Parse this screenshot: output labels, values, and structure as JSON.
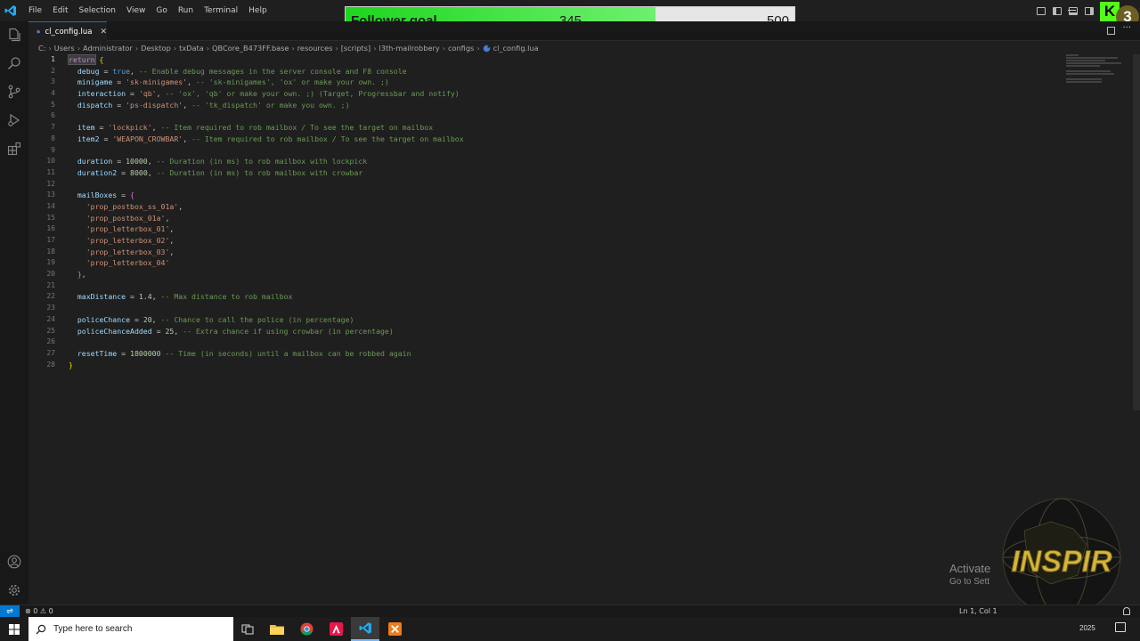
{
  "menu": [
    "File",
    "Edit",
    "Selection",
    "View",
    "Go",
    "Run",
    "Terminal",
    "Help"
  ],
  "overlay": {
    "goal_label": "Follower goal",
    "current": "345",
    "target": "500",
    "progress": 0.69,
    "kick_letter": "K",
    "kick_count": "3"
  },
  "tab": {
    "label": "cl_config.lua",
    "close": "✕"
  },
  "breadcrumb": [
    "C:",
    "Users",
    "Administrator",
    "Desktop",
    "txData",
    "QBCore_B473FF.base",
    "resources",
    "[scripts]",
    "l3th-mailrobbery",
    "configs",
    "cl_config.lua"
  ],
  "line_numbers": [
    "1",
    "2",
    "3",
    "4",
    "5",
    "6",
    "7",
    "8",
    "9",
    "10",
    "11",
    "12",
    "13",
    "14",
    "15",
    "16",
    "17",
    "18",
    "19",
    "20",
    "21",
    "22",
    "23",
    "24",
    "25",
    "26",
    "27",
    "28"
  ],
  "code": {
    "l1_kw": "return",
    "l1_br": " {",
    "l2_prop": "debug",
    "l2_eq": " = ",
    "l2_val": "true",
    "l2_rest": ", ",
    "l2_cmt": "-- Enable debug messages in the server console and F8 console",
    "l3_prop": "minigame",
    "l3_eq": " = ",
    "l3_val": "'sk-minigames'",
    "l3_rest": ", ",
    "l3_cmt": "-- 'sk-minigames', 'ox' or make your own. ;)",
    "l4_prop": "interaction",
    "l4_eq": " = ",
    "l4_val": "'qb'",
    "l4_rest": ", ",
    "l4_cmt": "-- 'ox', 'qb' or make your own. ;) (Target, Progressbar and notify)",
    "l5_prop": "dispatch",
    "l5_eq": " = ",
    "l5_val": "'ps-dispatch'",
    "l5_rest": ", ",
    "l5_cmt": "-- 'tk_dispatch' or make you own. ;)",
    "l7_prop": "item",
    "l7_eq": " = ",
    "l7_val": "'lockpick'",
    "l7_rest": ", ",
    "l7_cmt": "-- Item required to rob mailbox / To see the target on mailbox",
    "l8_prop": "item2",
    "l8_eq": " = ",
    "l8_val": "'WEAPON_CROWBAR'",
    "l8_rest": ", ",
    "l8_cmt": "-- Item required to rob mailbox / To see the target on mailbox",
    "l10_prop": "duration",
    "l10_eq": " = ",
    "l10_val": "10000",
    "l10_rest": ", ",
    "l10_cmt": "-- Duration (in ms) to rob mailbox with lockpick",
    "l11_prop": "duration2",
    "l11_eq": " = ",
    "l11_val": "8000",
    "l11_rest": ", ",
    "l11_cmt": "-- Duration (in ms) to rob mailbox with crowbar",
    "l13_prop": "mailBoxes",
    "l13_eq": " = ",
    "l13_br": "{",
    "l14": "'prop_postbox_ss_01a'",
    "l15": "'prop_postbox_01a'",
    "l16": "'prop_letterbox_01'",
    "l17": "'prop_letterbox_02'",
    "l18": "'prop_letterbox_03'",
    "l19": "'prop_letterbox_04'",
    "comma": ",",
    "l20_br": "}",
    "l20_rest": ",",
    "l22_prop": "maxDistance",
    "l22_eq": " = ",
    "l22_val": "1.4",
    "l22_rest": ", ",
    "l22_cmt": "-- Max distance to rob mailbox",
    "l24_prop": "policeChance",
    "l24_eq": " = ",
    "l24_val": "20",
    "l24_rest": ", ",
    "l24_cmt": "-- Chance to call the police (in percentage)",
    "l25_prop": "policeChanceAdded",
    "l25_eq": " = ",
    "l25_val": "25",
    "l25_rest": ", ",
    "l25_cmt": "-- Extra chance if using crowbar (in percentage)",
    "l27_prop": "resetTime",
    "l27_eq": " = ",
    "l27_val": "1800000",
    "l27_rest": " ",
    "l27_cmt": "-- Time (in seconds) until a mailbox can be robbed again",
    "l28_br": "}"
  },
  "status": {
    "problems": "⊗ 0 ⚠ 0",
    "cursor": "Ln 1, Col 1"
  },
  "watermark": {
    "title": "Activate",
    "subtitle": "Go to Sett"
  },
  "taskbar": {
    "search_placeholder": "Type here to search",
    "time": "2025"
  },
  "colors": {
    "accent": "#0078d4",
    "goal_fill": "#1ed61e",
    "kick_green": "#53fc18"
  }
}
